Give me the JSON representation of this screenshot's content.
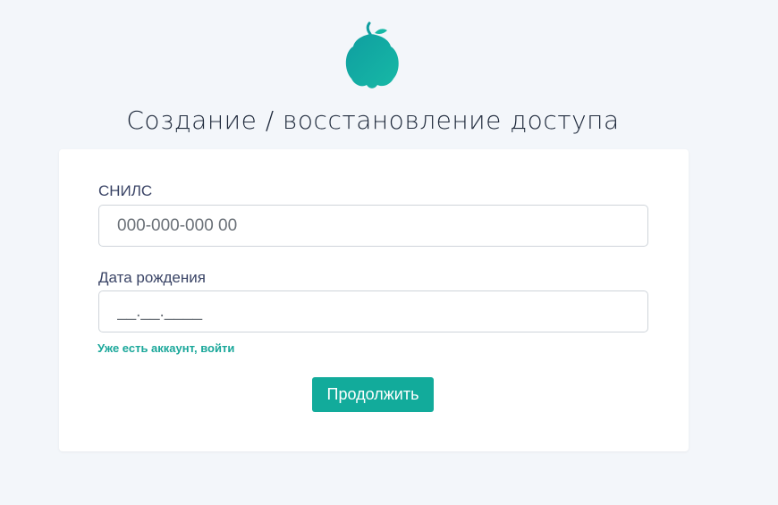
{
  "logo": {
    "icon": "quince-logo-icon",
    "color_top": "#1bb6a5",
    "color_bottom": "#0e8f9a"
  },
  "page": {
    "title": "Создание / восстановление доступа"
  },
  "form": {
    "snils_label": "СНИЛС",
    "snils_placeholder": "000-000-000 00",
    "birthdate_label": "Дата рождения",
    "birthdate_placeholder": "__.__.____",
    "login_link": "Уже есть аккаунт, войти",
    "submit_label": "Продолжить"
  },
  "colors": {
    "accent": "#12ab9b",
    "background": "#f3f6fa",
    "link": "#1aa79a"
  }
}
